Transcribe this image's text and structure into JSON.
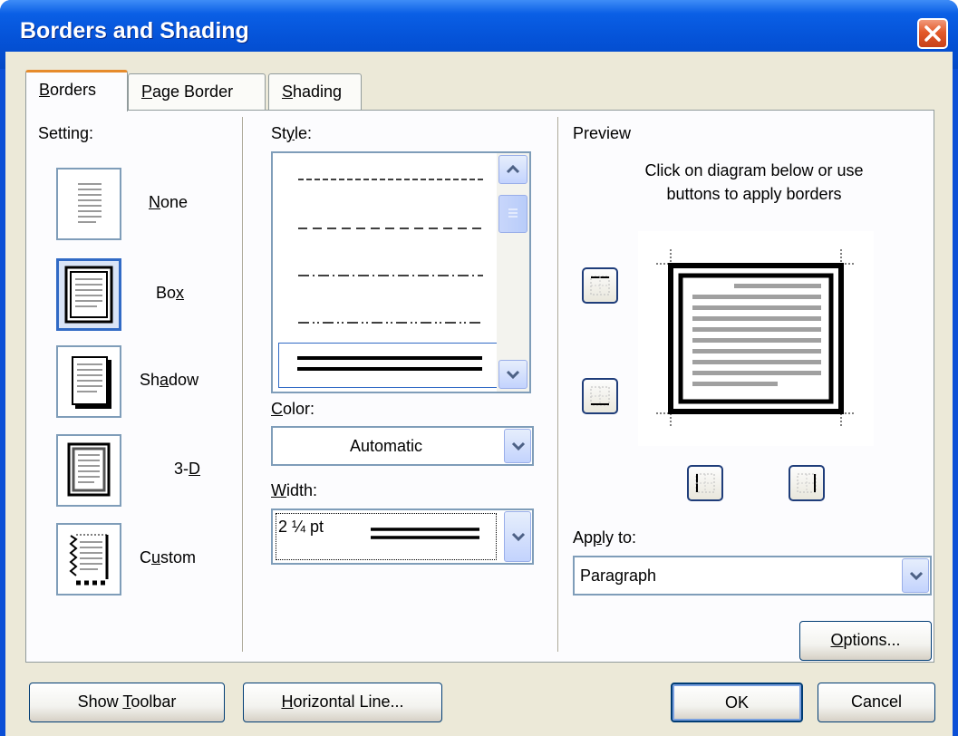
{
  "window": {
    "title": "Borders and Shading"
  },
  "tabs": [
    {
      "pre": "",
      "key": "B",
      "post": "orders"
    },
    {
      "pre": "",
      "key": "P",
      "post": "age Border"
    },
    {
      "pre": "",
      "key": "S",
      "post": "hading"
    }
  ],
  "setting": {
    "label": "Setting:",
    "options": [
      {
        "pre": "",
        "key": "N",
        "post": "one"
      },
      {
        "pre": "Bo",
        "key": "x",
        "post": ""
      },
      {
        "pre": "Sh",
        "key": "a",
        "post": "dow"
      },
      {
        "pre": "3-",
        "key": "D",
        "post": ""
      },
      {
        "pre": "C",
        "key": "u",
        "post": "stom"
      }
    ],
    "selected": "Box"
  },
  "style": {
    "pre": "St",
    "key": "y",
    "post": "le:"
  },
  "color": {
    "pre": "",
    "key": "C",
    "post": "olor:",
    "value": "Automatic"
  },
  "width": {
    "pre": "",
    "key": "W",
    "post": "idth:",
    "value": "2 ¼ pt"
  },
  "preview": {
    "label": "Preview",
    "hint_line1": "Click on diagram below or use",
    "hint_line2": "buttons to apply borders"
  },
  "apply_to": {
    "pre": "Ap",
    "key": "p",
    "post": "ly to:",
    "value": "Paragraph"
  },
  "buttons": {
    "options": {
      "pre": "",
      "key": "O",
      "post": "ptions..."
    },
    "show_toolbar": {
      "pre": "Show ",
      "key": "T",
      "post": "oolbar"
    },
    "horizontal_line": {
      "pre": "",
      "key": "H",
      "post": "orizontal Line..."
    },
    "ok": "OK",
    "cancel": "Cancel"
  },
  "colors": {
    "title_blue": "#0553d8",
    "face": "#ece9d8",
    "select_blue": "#316ac5",
    "close_red": "#e35a2a"
  }
}
